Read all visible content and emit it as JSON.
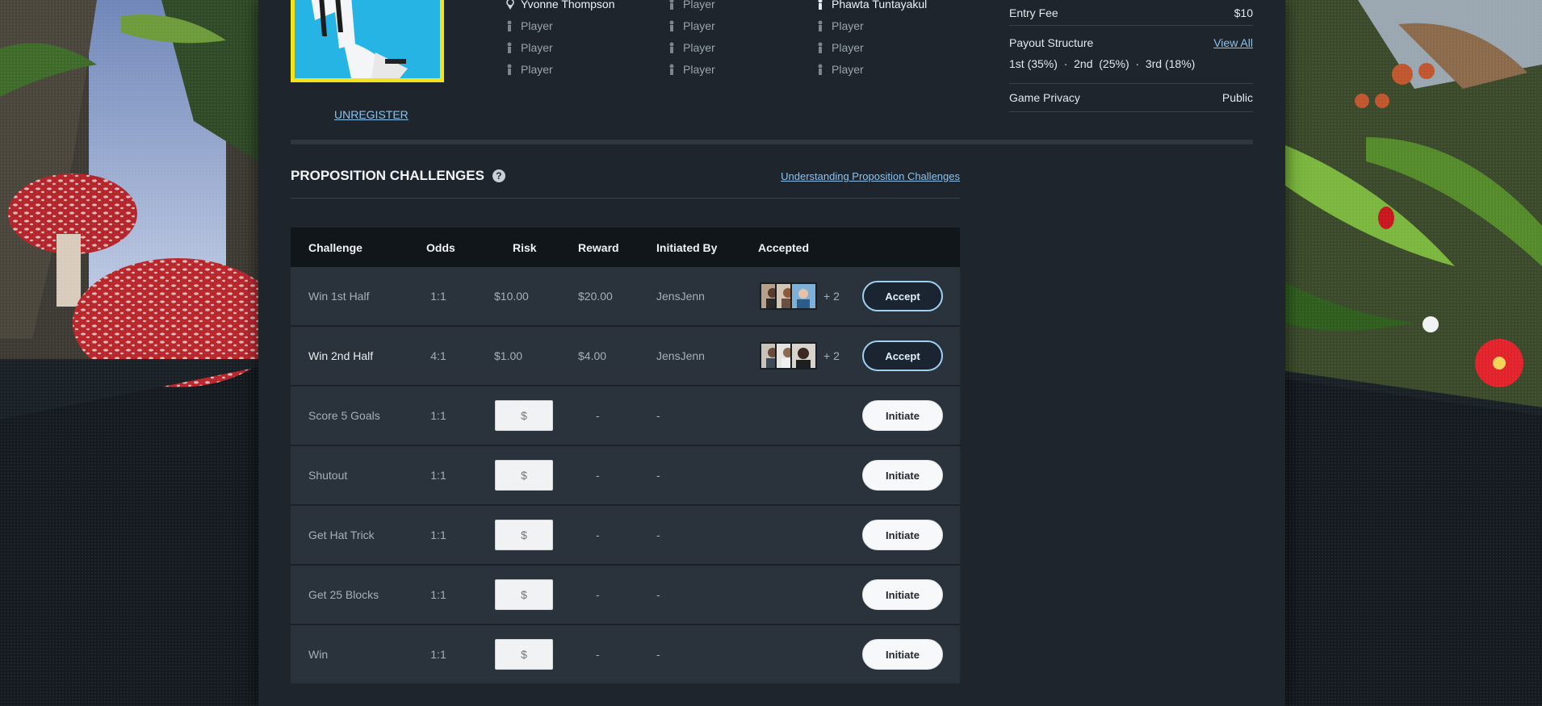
{
  "roster": {
    "columns": [
      {
        "top_name": "Yvonne Thompson",
        "players": [
          "Player",
          "Player",
          "Player"
        ]
      },
      {
        "top_name": "Player",
        "players": [
          "Player",
          "Player",
          "Player"
        ]
      },
      {
        "top_name": "Phawta Tuntayakul",
        "players": [
          "Player",
          "Player",
          "Player"
        ]
      }
    ],
    "unregister_label": "UNREGISTER"
  },
  "game_info": {
    "entry_fee_label": "Entry Fee",
    "entry_fee_value": "$10",
    "payout_label": "Payout Structure",
    "payout_link": "View All",
    "payout_detail": "1st (35%)  ·  2nd  (25%)  ·  3rd (18%)",
    "privacy_label": "Game Privacy",
    "privacy_value": "Public"
  },
  "challenges": {
    "title": "PROPOSITION CHALLENGES",
    "help_icon": "question-circle-icon",
    "understanding_link": "Understanding Proposition Challenges",
    "columns": [
      "Challenge",
      "Odds",
      "Risk",
      "Reward",
      "Initiated By",
      "Accepted"
    ],
    "risk_placeholder": "$",
    "rows": [
      {
        "challenge": "Win 1st Half",
        "odds": "1:1",
        "risk": "$10.00",
        "reward": "$20.00",
        "initiated_by": "JensJenn",
        "accepted_more": "+ 2",
        "action": "Accept"
      },
      {
        "challenge": "Win 2nd Half",
        "odds": "4:1",
        "risk": "$1.00",
        "reward": "$4.00",
        "initiated_by": "JensJenn",
        "accepted_more": "+ 2",
        "action": "Accept"
      },
      {
        "challenge": "Score 5 Goals",
        "odds": "1:1",
        "reward": "-",
        "initiated_by": "-",
        "action": "Initiate"
      },
      {
        "challenge": "Shutout",
        "odds": "1:1",
        "reward": "-",
        "initiated_by": "-",
        "action": "Initiate"
      },
      {
        "challenge": "Get Hat Trick",
        "odds": "1:1",
        "reward": "-",
        "initiated_by": "-",
        "action": "Initiate"
      },
      {
        "challenge": "Get 25 Blocks",
        "odds": "1:1",
        "reward": "-",
        "initiated_by": "-",
        "action": "Initiate"
      },
      {
        "challenge": "Win",
        "odds": "1:1",
        "reward": "-",
        "initiated_by": "-",
        "action": "Initiate"
      }
    ]
  },
  "colors": {
    "panel": "#1e252c",
    "link": "#8fc1e8",
    "accent_border": "#9fd0f2",
    "card_border": "#f2e31a"
  }
}
